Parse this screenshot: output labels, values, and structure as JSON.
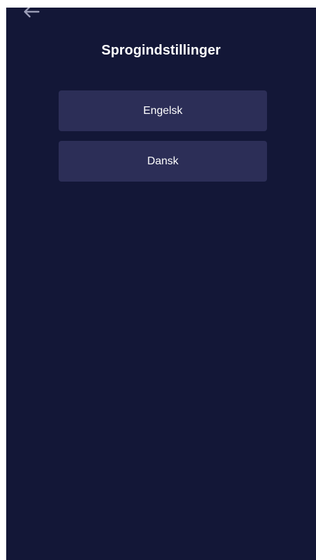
{
  "header": {
    "title": "Sprogindstillinger",
    "back_icon": "arrow-left-icon"
  },
  "languages": [
    {
      "label": "Engelsk"
    },
    {
      "label": "Dansk"
    }
  ],
  "colors": {
    "background": "#131737",
    "button": "#2c2e57",
    "text": "#ffffff",
    "icon": "#9a9cb6"
  }
}
